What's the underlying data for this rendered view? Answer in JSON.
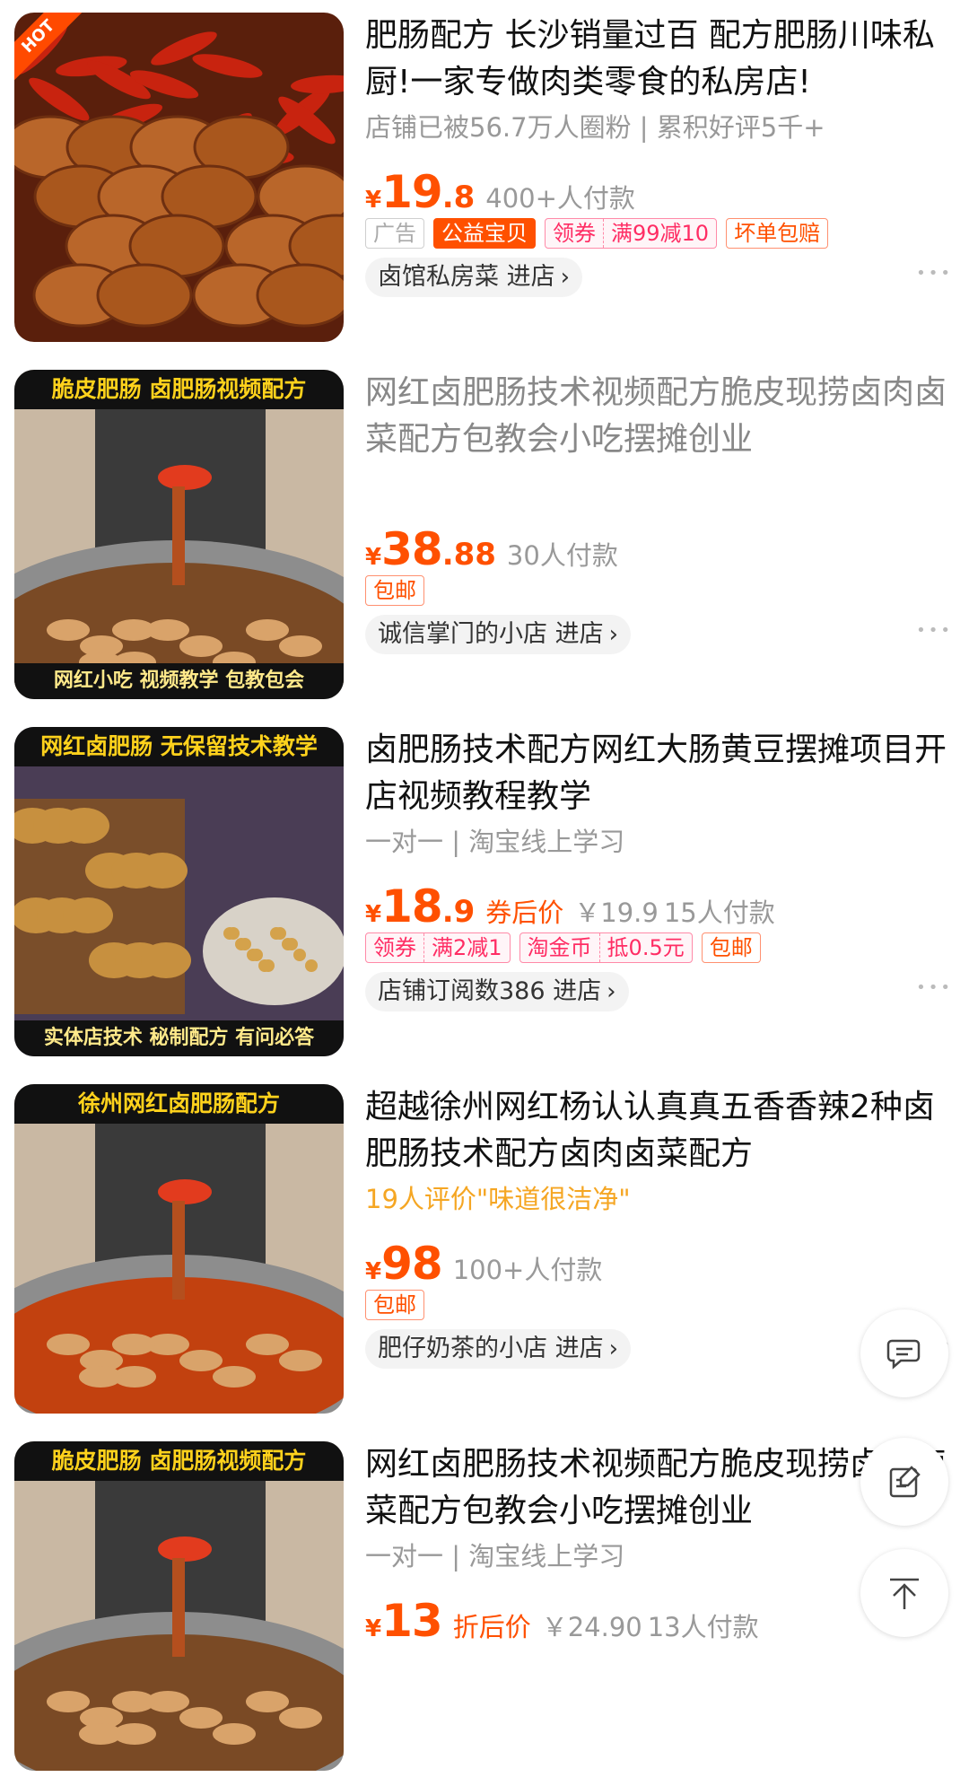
{
  "colors": {
    "price": "#ff5000",
    "tag_border": "#ff9070",
    "highlight": "#f5a623"
  },
  "products": [
    {
      "title": "肥肠配方 长沙销量过百 配方肥肠川味私厨!一家专做肉类零食的私房店!",
      "title_visited": false,
      "sub": "店铺已被56.7万人圈粉 | 累积好评5千+",
      "sub_highlight": false,
      "price_int": "19",
      "price_dec": ".8",
      "price_label": "",
      "orig": "",
      "sales": "400+人付款",
      "tags": [
        {
          "text": "广告",
          "style": "ad"
        },
        {
          "text": "公益宝贝",
          "style": "solid"
        },
        {
          "text": "领券",
          "text2": "满99减10",
          "style": "pair"
        },
        {
          "text": "坏单包赔",
          "style": "normal"
        }
      ],
      "shop": "卤馆私房菜 进店",
      "image": {
        "badge": "HOT",
        "banner_top": "",
        "banner_bottom": "",
        "scene": "meat"
      }
    },
    {
      "title": "网红卤肥肠技术视频配方脆皮现捞卤肉卤菜配方包教会小吃摆摊创业",
      "title_visited": true,
      "sub": "",
      "sub_highlight": false,
      "price_int": "38",
      "price_dec": ".88",
      "price_label": "",
      "orig": "",
      "sales": "30人付款",
      "tags": [
        {
          "text": "包邮",
          "style": "normal"
        }
      ],
      "shop": "诚信掌门的小店 进店",
      "image": {
        "badge": "",
        "banner_top": "脆皮肥肠 卤肥肠视频配方",
        "banner_bottom": "网红小吃 视频教学 包教包会",
        "scene": "pot"
      }
    },
    {
      "title": "卤肥肠技术配方网红大肠黄豆摆摊项目开店视频教程教学",
      "title_visited": false,
      "sub": "一对一 | 淘宝线上学习",
      "sub_highlight": false,
      "price_int": "18",
      "price_dec": ".9",
      "price_label": "券后价",
      "orig": "￥19.9",
      "sales": "15人付款",
      "tags": [
        {
          "text": "领券",
          "text2": "满2减1",
          "style": "pair"
        },
        {
          "text": "淘金币",
          "text2": "抵0.5元",
          "style": "pair"
        },
        {
          "text": "包邮",
          "style": "normal"
        }
      ],
      "shop": "店铺订阅数386 进店",
      "image": {
        "badge": "",
        "banner_top": "网红卤肥肠 无保留技术教学",
        "banner_bottom": "实体店技术 秘制配方 有问必答",
        "scene": "purple"
      }
    },
    {
      "title": "超越徐州网红杨认认真真五香香辣2种卤肥肠技术配方卤肉卤菜配方",
      "title_visited": false,
      "sub": "19人评价\"味道很洁净\"",
      "sub_highlight": true,
      "price_int": "98",
      "price_dec": "",
      "price_label": "",
      "orig": "",
      "sales": "100+人付款",
      "tags": [
        {
          "text": "包邮",
          "style": "normal"
        }
      ],
      "shop": "肥仔奶茶的小店 进店",
      "image": {
        "badge": "",
        "banner_top": "徐州网红卤肥肠配方",
        "banner_bottom": "",
        "scene": "redpot"
      }
    },
    {
      "title": "网红卤肥肠技术视频配方脆皮现捞卤肉卤菜配方包教会小吃摆摊创业",
      "title_visited": false,
      "sub": "一对一 | 淘宝线上学习",
      "sub_highlight": false,
      "price_int": "13",
      "price_dec": "",
      "price_label": "折后价",
      "orig": "￥24.90",
      "sales": "13人付款",
      "tags": [],
      "shop": "",
      "image": {
        "badge": "",
        "banner_top": "脆皮肥肠 卤肥肠视频配方",
        "banner_bottom": "",
        "scene": "pot"
      }
    }
  ],
  "fabs": [
    {
      "name": "chat-icon"
    },
    {
      "name": "feedback-icon"
    },
    {
      "name": "back-to-top-icon"
    }
  ]
}
